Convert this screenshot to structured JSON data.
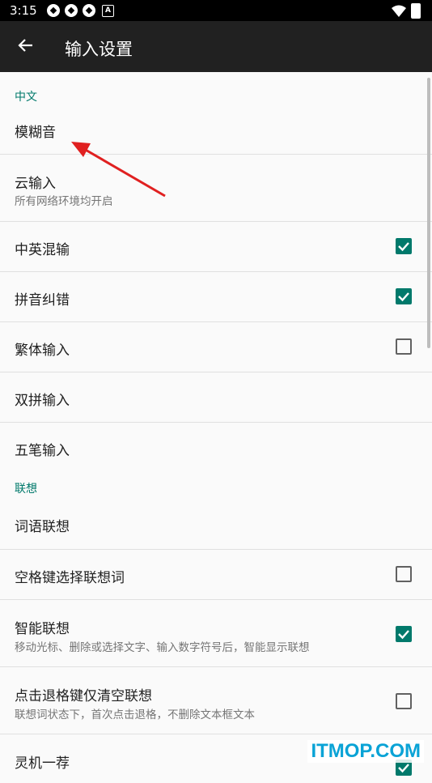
{
  "status": {
    "time": "3:15",
    "a_badge": "A"
  },
  "appbar": {
    "title": "输入设置",
    "back_icon": "arrow-back-icon"
  },
  "sections": {
    "chinese": {
      "header": "中文",
      "fuzzy": "模糊音",
      "cloud_title": "云输入",
      "cloud_summary": "所有网络环境均开启",
      "mixed": "中英混输",
      "correction": "拼音纠错",
      "traditional": "繁体输入",
      "shuangpin": "双拼输入",
      "wubi": "五笔输入"
    },
    "association": {
      "header": "联想",
      "word": "词语联想",
      "space": "空格键选择联想词",
      "smart_title": "智能联想",
      "smart_summary": "移动光标、删除或选择文字、输入数字符号后，智能显示联想",
      "backspace_title": "点击退格键仅清空联想",
      "backspace_summary": "联想词状态下，首次点击退格，不删除文本框文本",
      "lingji": "灵机一荐"
    }
  },
  "checkbox_states": {
    "mixed": true,
    "correction": true,
    "traditional": false,
    "space": false,
    "smart": true,
    "backspace": false,
    "lingji": true
  },
  "colors": {
    "accent": "#00796b",
    "appbar": "#212121",
    "annotation_arrow": "#e02020"
  },
  "watermark": "ITMOP.COM"
}
